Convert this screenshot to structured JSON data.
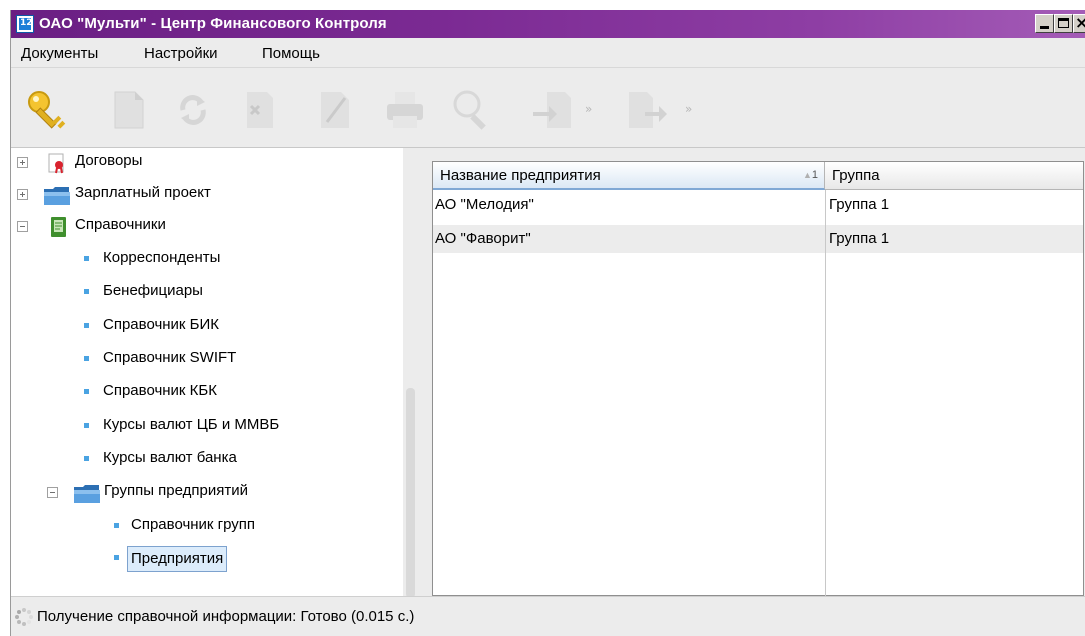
{
  "window": {
    "title": "ОАО \"Мульти\" - Центр Финансового Контроля"
  },
  "menu": {
    "documents": "Документы",
    "settings": "Настройки",
    "help": "Помощь"
  },
  "toolbar": {
    "icons": [
      "key-icon",
      "document-icon",
      "refresh-icon",
      "delete-icon",
      "sign-icon",
      "print-icon",
      "search-icon",
      "import-icon",
      "export-icon"
    ],
    "dropdown_arrow": "»"
  },
  "tree": {
    "items": [
      {
        "label": "Договоры",
        "icon": "contract-icon",
        "expander": "plus"
      },
      {
        "label": "Зарплатный проект",
        "icon": "folder-icon",
        "expander": "plus"
      },
      {
        "label": "Справочники",
        "icon": "book-icon",
        "expander": "minus"
      },
      {
        "label": "Корреспонденты"
      },
      {
        "label": "Бенефициары"
      },
      {
        "label": "Справочник БИК"
      },
      {
        "label": "Справочник SWIFT"
      },
      {
        "label": "Справочник КБК"
      },
      {
        "label": "Курсы валют ЦБ и ММВБ"
      },
      {
        "label": "Курсы валют банка"
      },
      {
        "label": "Группы предприятий",
        "icon": "folder-icon",
        "expander": "minus"
      },
      {
        "label": "Справочник групп"
      },
      {
        "label": "Предприятия",
        "selected": true
      }
    ]
  },
  "table": {
    "columns": [
      "Название предприятия",
      "Группа"
    ],
    "sort_indicator": "1",
    "sort_arrow": "▲",
    "rows": [
      [
        "АО \"Мелодия\"",
        "Группа 1"
      ],
      [
        "АО \"Фаворит\"",
        "Группа 1"
      ]
    ]
  },
  "status": {
    "text": "Получение справочной информации: Готово (0.015 с.)"
  },
  "colors": {
    "titlebar": "#7b2a93",
    "selection": "#dcecfb",
    "bullet": "#4aa3e2"
  }
}
